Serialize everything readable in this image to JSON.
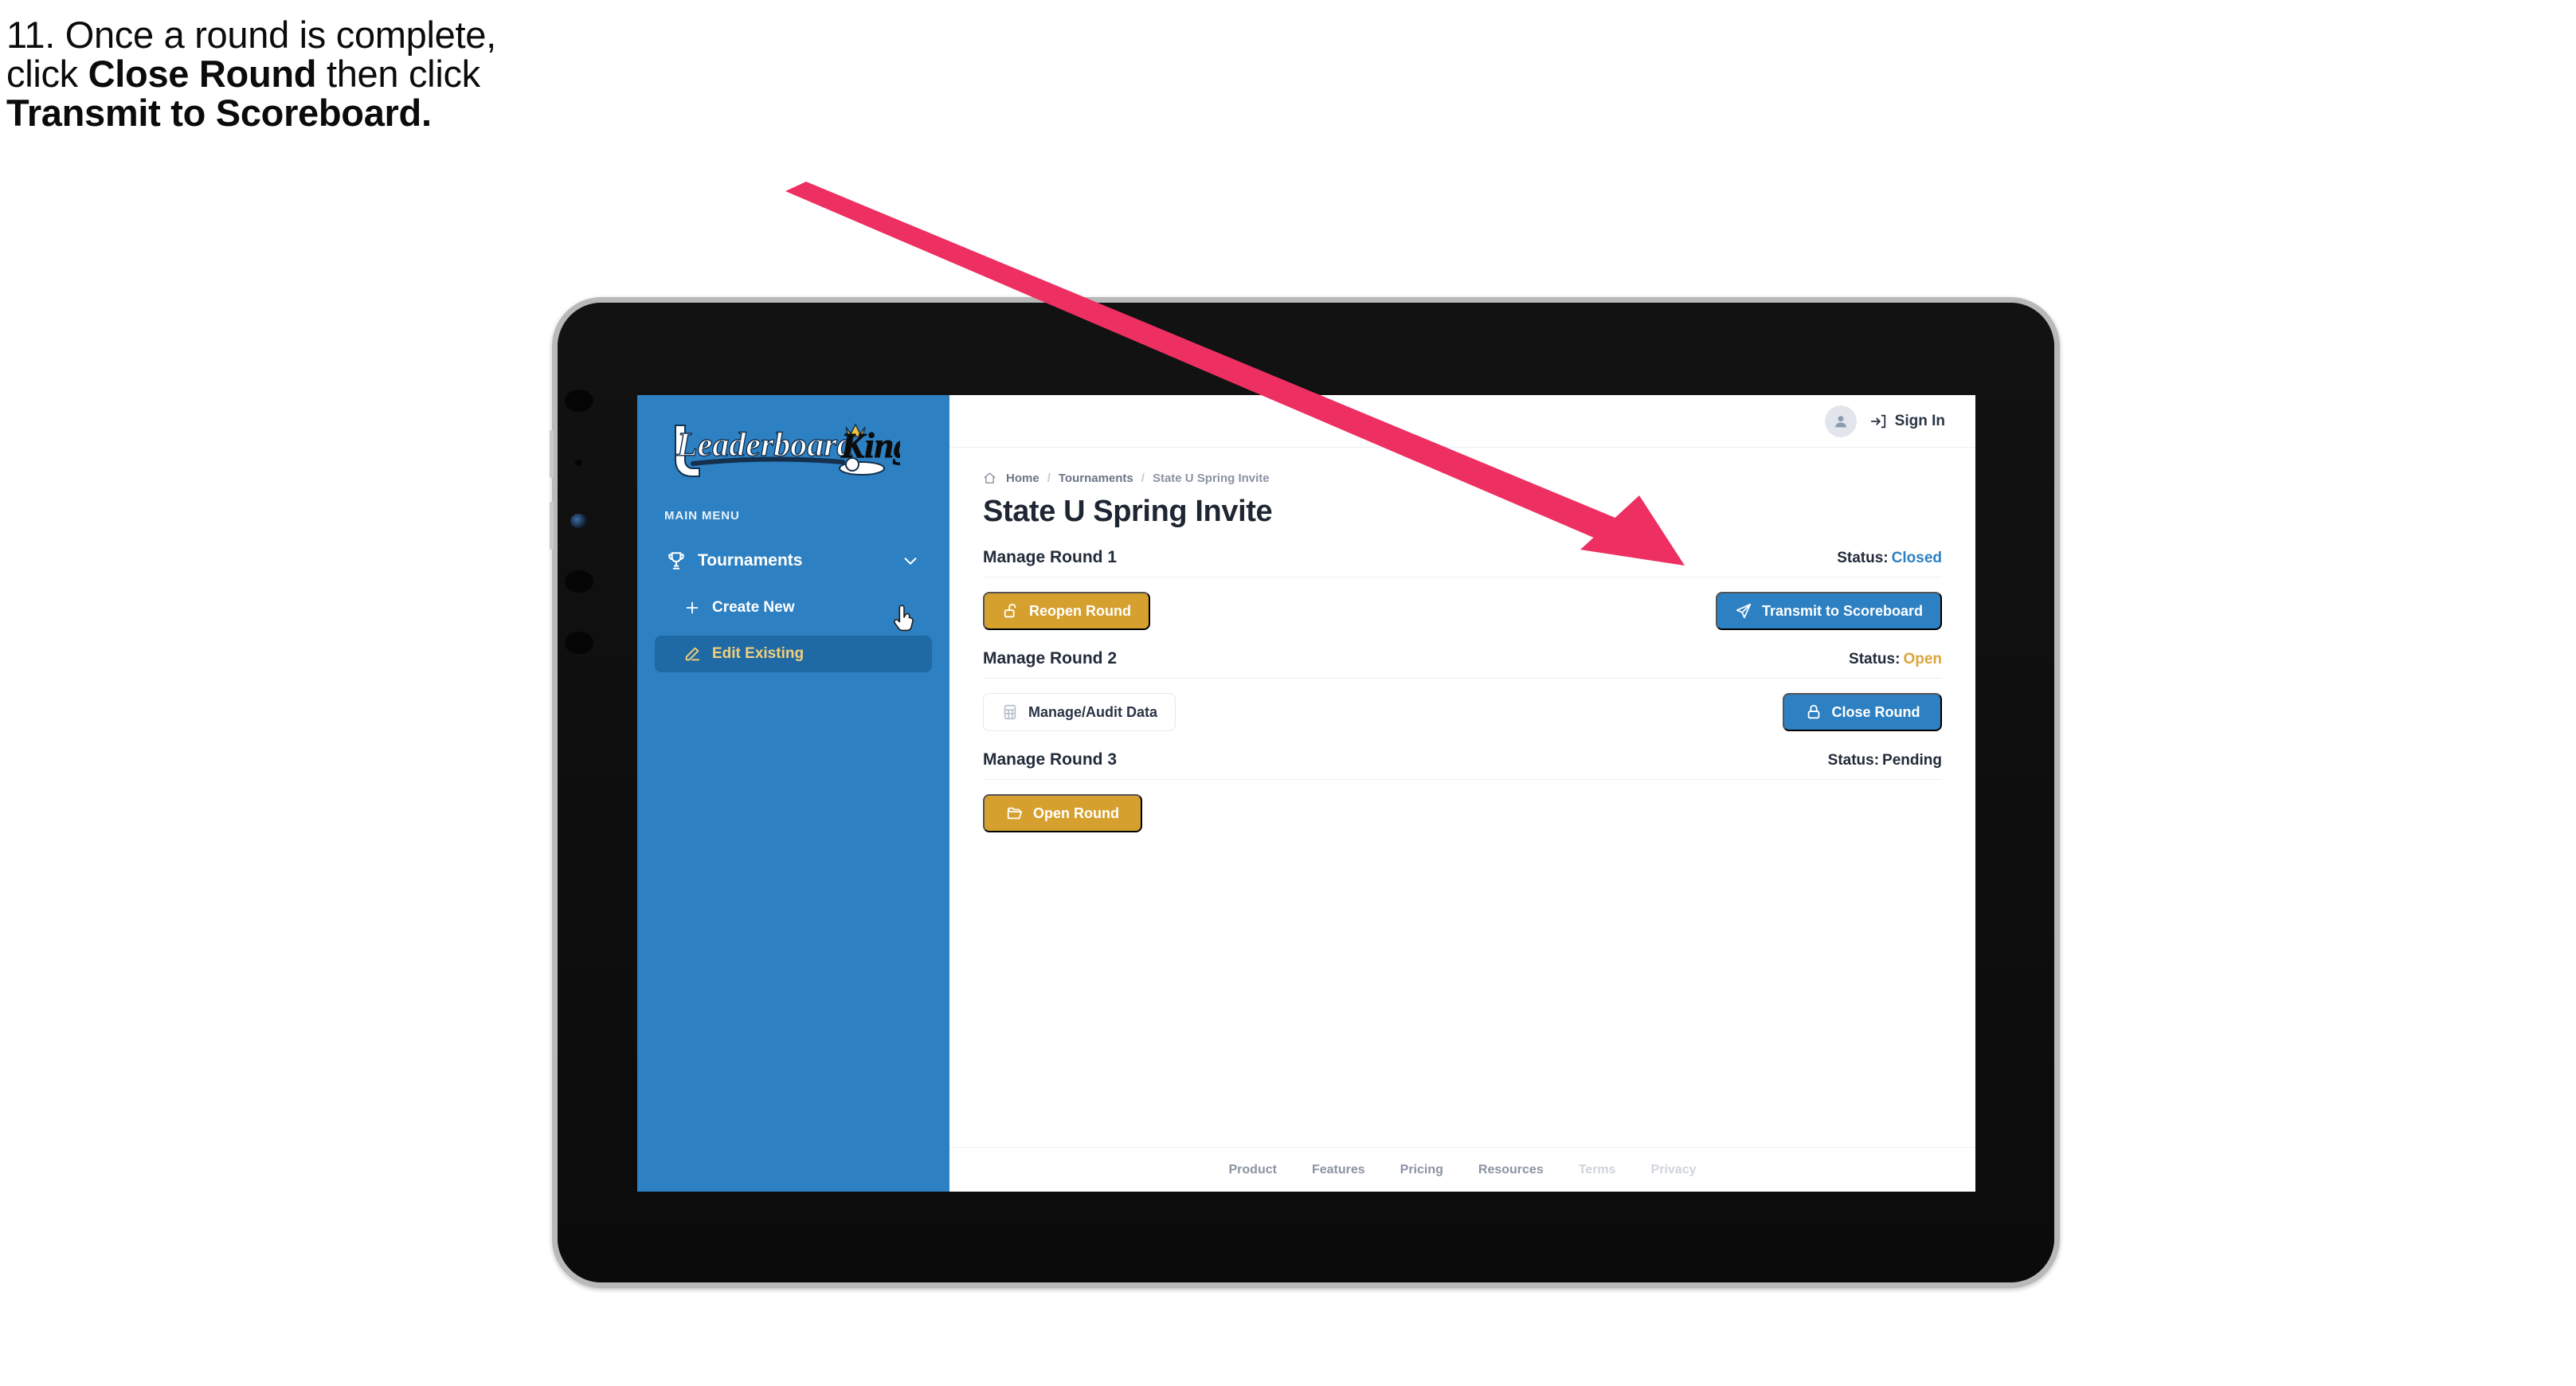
{
  "caption": {
    "line1": "11. Once a round is complete,",
    "line2_pre": "click ",
    "line2_bold": "Close Round",
    "line2_post": " then click",
    "line3_bold": "Transmit to Scoreboard."
  },
  "colors": {
    "sidebar_blue": "#2d80c2",
    "accent_amber": "#d5a02e",
    "accent_blue": "#2d80c2",
    "arrow_pink": "#ed2f62",
    "text_dark": "#222b3a"
  },
  "sidebar": {
    "logo_text_left": "Leaderboard",
    "logo_text_right": "King",
    "section_label": "MAIN MENU",
    "nav": [
      {
        "label": "Tournaments",
        "icon": "trophy-icon",
        "chevron": "chevron-down-icon"
      }
    ],
    "sub_items": [
      {
        "label": "Create New",
        "icon": "plus-icon",
        "active": false
      },
      {
        "label": "Edit Existing",
        "icon": "edit-square-icon",
        "active": true
      }
    ]
  },
  "topbar": {
    "avatar_icon": "user-avatar-icon",
    "signin_icon": "sign-in-icon",
    "signin_label": "Sign In"
  },
  "breadcrumb": {
    "home_icon": "home-icon",
    "items": [
      "Home",
      "Tournaments",
      "State U Spring Invite"
    ],
    "separator": "/"
  },
  "page": {
    "title": "State U Spring Invite"
  },
  "rounds": [
    {
      "title": "Manage Round 1",
      "status_label": "Status:",
      "status_value": "Closed",
      "status_kind": "closed",
      "left_button": {
        "label": "Reopen Round",
        "icon": "unlock-icon",
        "style": "amber"
      },
      "right_button": {
        "label": "Transmit to Scoreboard",
        "icon": "send-icon",
        "style": "blue"
      }
    },
    {
      "title": "Manage Round 2",
      "status_label": "Status:",
      "status_value": "Open",
      "status_kind": "open",
      "left_button": {
        "label": "Manage/Audit Data",
        "icon": "table-grid-icon",
        "style": "ghost"
      },
      "right_button": {
        "label": "Close Round",
        "icon": "lock-icon",
        "style": "blue"
      }
    },
    {
      "title": "Manage Round 3",
      "status_label": "Status:",
      "status_value": "Pending",
      "status_kind": "pending",
      "left_button": {
        "label": "Open Round",
        "icon": "folder-open-icon",
        "style": "amber"
      },
      "right_button": null
    }
  ],
  "footer": {
    "links": [
      "Product",
      "Features",
      "Pricing",
      "Resources",
      "Terms",
      "Privacy"
    ]
  }
}
